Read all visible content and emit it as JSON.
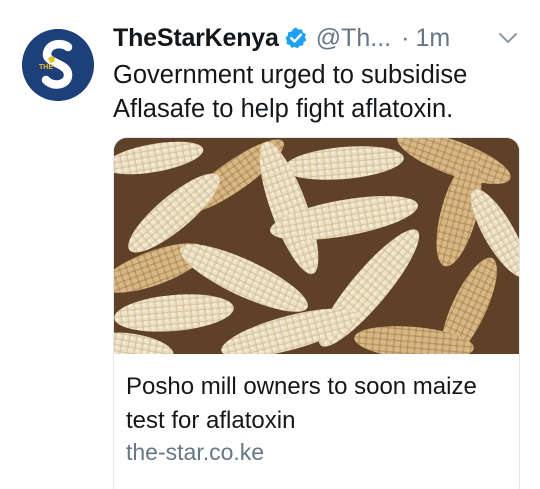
{
  "tweet": {
    "display_name": "TheStarKenya",
    "handle": "@Th...",
    "separator": "·",
    "time": "1m",
    "text": "Government urged to subsidise Aflasafe to help fight aflatoxin."
  },
  "avatar": {
    "letter": "S",
    "small_text": "THE"
  },
  "icons": {
    "verified": "verified-badge-icon",
    "menu": "chevron-down-icon"
  },
  "card": {
    "title": "Posho mill owners to soon maize test for aflatoxin",
    "domain": "the-star.co.ke",
    "image": "photo of dried maize cobs"
  },
  "colors": {
    "brand": "#1d3f7a",
    "verified": "#1da1f2",
    "text": "#14171a",
    "secondary": "#657786",
    "border": "#e1e8ed"
  }
}
